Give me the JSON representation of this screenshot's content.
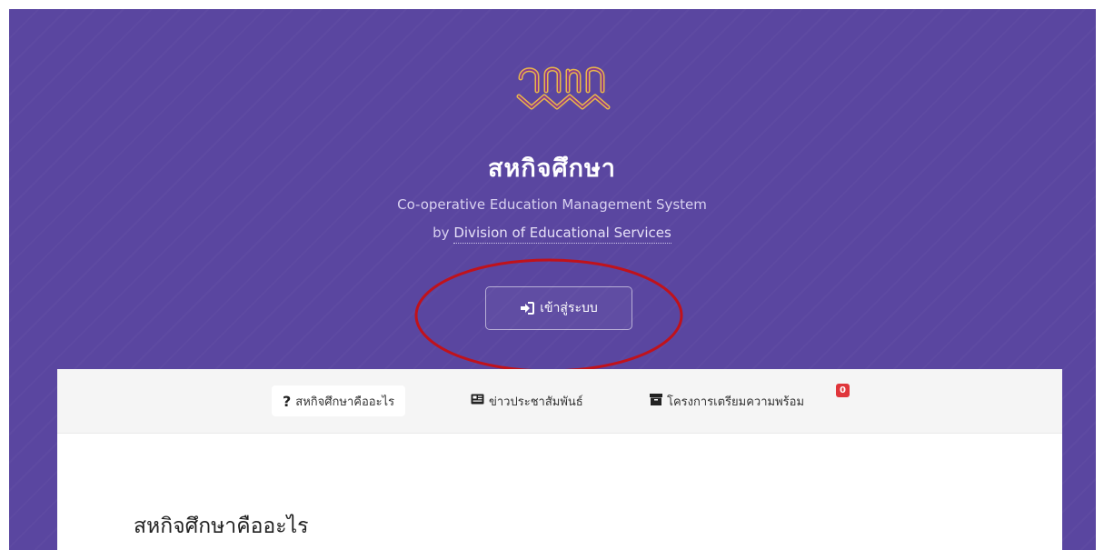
{
  "header": {
    "logo": "cmu-logo-icon",
    "title": "สหกิจศึกษา",
    "subtitle": "Co-operative Education Management System",
    "byline_prefix": "by",
    "byline_link": "Division of Educational Services"
  },
  "login": {
    "label": "เข้าสู่ระบบ",
    "icon": "sign-in-icon"
  },
  "tabs": [
    {
      "label": "สหกิจศึกษาคืออะไร",
      "icon": "question-icon",
      "active": true
    },
    {
      "label": "ข่าวประชาสัมพันธ์",
      "icon": "newspaper-icon",
      "active": false
    },
    {
      "label": "โครงการเตรียมความพร้อม",
      "icon": "archive-icon",
      "active": false,
      "badge": "0"
    }
  ],
  "main": {
    "section_title": "สหกิจศึกษาคืออะไร"
  },
  "colors": {
    "hero_bg": "#5a46a0",
    "badge": "#e0363b",
    "annotation": "#c0121b",
    "logo_gold": "#e8b74a"
  }
}
